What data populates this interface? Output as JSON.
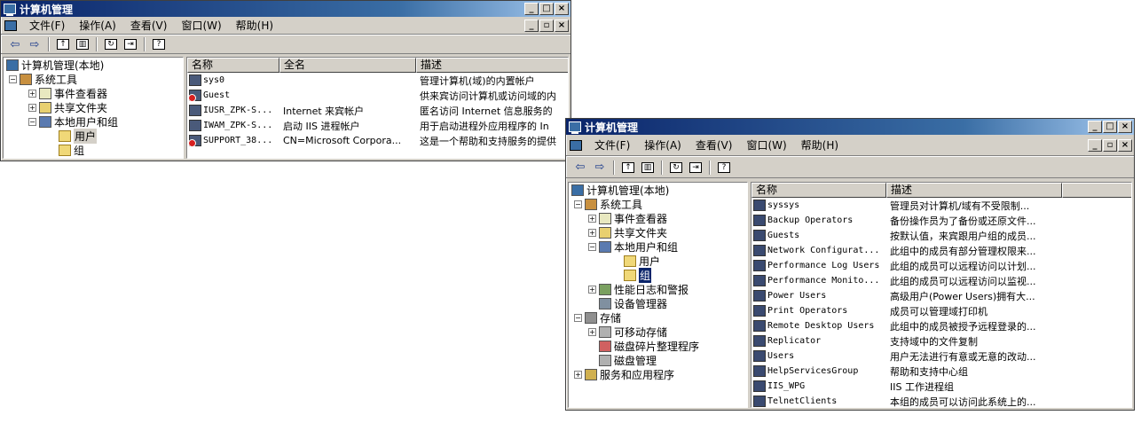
{
  "window1": {
    "title": "计算机管理",
    "menu": [
      "文件(F)",
      "操作(A)",
      "查看(V)",
      "窗口(W)",
      "帮助(H)"
    ],
    "tree": [
      {
        "label": "计算机管理(本地)",
        "level": 0,
        "expander": "",
        "icon": "computer-icon"
      },
      {
        "label": "系统工具",
        "level": 1,
        "expander": "−",
        "icon": "tools-icon"
      },
      {
        "label": "事件查看器",
        "level": 2,
        "expander": "+",
        "icon": "event-viewer-icon"
      },
      {
        "label": "共享文件夹",
        "level": 2,
        "expander": "+",
        "icon": "shared-folder-icon"
      },
      {
        "label": "本地用户和组",
        "level": 2,
        "expander": "−",
        "icon": "users-icon"
      },
      {
        "label": "用户",
        "level": 3,
        "expander": "",
        "icon": "folder-icon",
        "selected": true
      },
      {
        "label": "组",
        "level": 3,
        "expander": "",
        "icon": "folder-icon"
      }
    ],
    "columns": [
      "名称",
      "全名",
      "描述"
    ],
    "rows": [
      {
        "name": "sys0",
        "fullname": "",
        "desc": "管理计算机(域)的内置帐户",
        "disabled": false
      },
      {
        "name": "Guest",
        "fullname": "",
        "desc": "供来宾访问计算机或访问域的内",
        "disabled": true
      },
      {
        "name": "IUSR_ZPK-S...",
        "fullname": "Internet 来宾帐户",
        "desc": "匿名访问 Internet 信息服务的",
        "disabled": false
      },
      {
        "name": "IWAM_ZPK-S...",
        "fullname": "启动 IIS 进程帐户",
        "desc": "用于启动进程外应用程序的 In",
        "disabled": false
      },
      {
        "name": "SUPPORT_38...",
        "fullname": "CN=Microsoft Corpora...",
        "desc": "这是一个帮助和支持服务的提供",
        "disabled": true
      }
    ]
  },
  "window2": {
    "title": "计算机管理",
    "menu": [
      "文件(F)",
      "操作(A)",
      "查看(V)",
      "窗口(W)",
      "帮助(H)"
    ],
    "tree": [
      {
        "label": "计算机管理(本地)",
        "level": 0,
        "expander": "",
        "icon": "computer-icon"
      },
      {
        "label": "系统工具",
        "level": 1,
        "expander": "−",
        "icon": "tools-icon"
      },
      {
        "label": "事件查看器",
        "level": 2,
        "expander": "+",
        "icon": "event-viewer-icon"
      },
      {
        "label": "共享文件夹",
        "level": 2,
        "expander": "+",
        "icon": "shared-folder-icon"
      },
      {
        "label": "本地用户和组",
        "level": 2,
        "expander": "−",
        "icon": "users-icon"
      },
      {
        "label": "用户",
        "level": 3,
        "expander": "",
        "icon": "folder-icon"
      },
      {
        "label": "组",
        "level": 3,
        "expander": "",
        "icon": "folder-icon",
        "selected": true
      },
      {
        "label": "性能日志和警报",
        "level": 2,
        "expander": "+",
        "icon": "performance-icon"
      },
      {
        "label": "设备管理器",
        "level": 2,
        "expander": "",
        "icon": "device-manager-icon"
      },
      {
        "label": "存储",
        "level": 1,
        "expander": "−",
        "icon": "storage-icon"
      },
      {
        "label": "可移动存储",
        "level": 2,
        "expander": "+",
        "icon": "removable-storage-icon"
      },
      {
        "label": "磁盘碎片整理程序",
        "level": 2,
        "expander": "",
        "icon": "defrag-icon"
      },
      {
        "label": "磁盘管理",
        "level": 2,
        "expander": "",
        "icon": "disk-management-icon"
      },
      {
        "label": "服务和应用程序",
        "level": 1,
        "expander": "+",
        "icon": "services-icon"
      }
    ],
    "columns": [
      "名称",
      "描述"
    ],
    "rows": [
      {
        "name": "syssys",
        "desc": "管理员对计算机/域有不受限制..."
      },
      {
        "name": "Backup Operators",
        "desc": "备份操作员为了备份或还原文件..."
      },
      {
        "name": "Guests",
        "desc": "按默认值，来宾跟用户组的成员..."
      },
      {
        "name": "Network Configurat...",
        "desc": "此组中的成员有部分管理权限来..."
      },
      {
        "name": "Performance Log Users",
        "desc": "此组的成员可以远程访问以计划..."
      },
      {
        "name": "Performance Monito...",
        "desc": "此组的成员可以远程访问以监视..."
      },
      {
        "name": "Power Users",
        "desc": "高级用户(Power Users)拥有大..."
      },
      {
        "name": "Print Operators",
        "desc": "成员可以管理域打印机"
      },
      {
        "name": "Remote Desktop Users",
        "desc": "此组中的成员被授予远程登录的..."
      },
      {
        "name": "Replicator",
        "desc": "支持域中的文件复制"
      },
      {
        "name": "Users",
        "desc": "用户无法进行有意或无意的改动..."
      },
      {
        "name": "HelpServicesGroup",
        "desc": "帮助和支持中心组"
      },
      {
        "name": "IIS_WPG",
        "desc": "IIS 工作进程组"
      },
      {
        "name": "TelnetClients",
        "desc": "本组的成员可以访问此系统上的..."
      }
    ]
  }
}
